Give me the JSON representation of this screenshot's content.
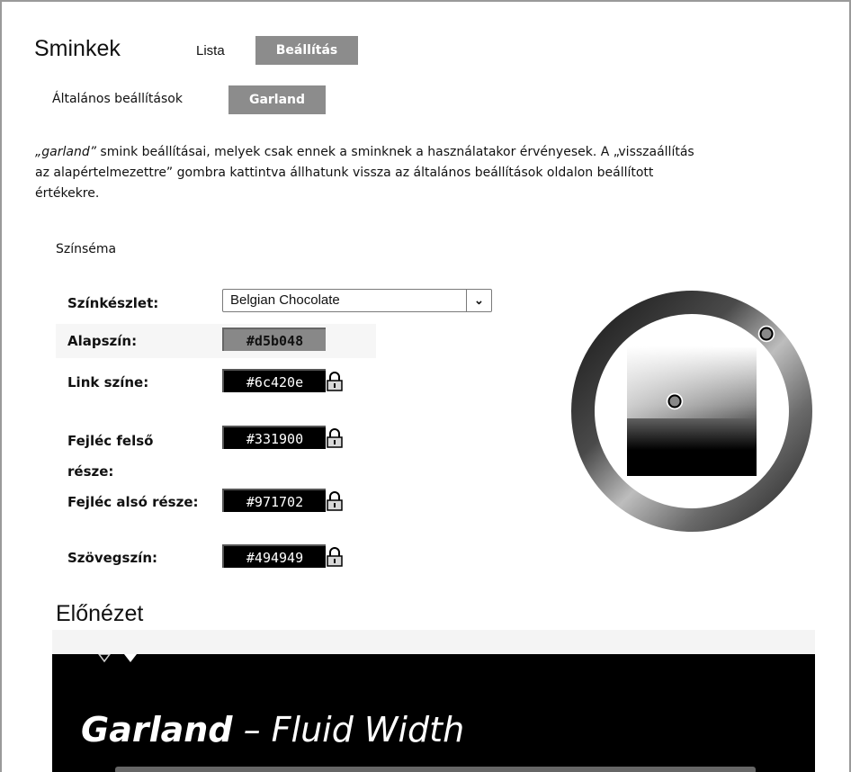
{
  "page": {
    "title": "Sminkek"
  },
  "tabs": {
    "list": "Lista",
    "settings": "Beállítás"
  },
  "subtabs": {
    "general": "Általános beállítások",
    "garland": "Garland"
  },
  "description": {
    "theme_name": "„garland”",
    "text_line1": " smink beállításai, melyek csak ennek a sminknek a használatakor érvényesek. A „visszaállítás",
    "text_line2": "az alapértelmezettre” gombra kattintva állhatunk vissza az általános beállítások oldalon beállított",
    "text_line3": "értékekre."
  },
  "color_scheme": {
    "section_label": "Színséma",
    "preset": {
      "label": "Színkészlet:",
      "value": "Belgian Chocolate"
    },
    "base": {
      "label": "Alapszín:",
      "value": "#d5b048"
    },
    "link": {
      "label": "Link színe:",
      "value": "#6c420e"
    },
    "top": {
      "label_line1": "Fejléc felső",
      "label_line2": "része:",
      "value": "#331900"
    },
    "bottom": {
      "label": "Fejléc alsó része:",
      "value": "#971702"
    },
    "text": {
      "label": "Szövegszín:",
      "value": "#494949"
    }
  },
  "preview": {
    "title": "Előnézet",
    "heading_bold": "Garland",
    "heading_rest": " – Fluid Width"
  },
  "icons": {
    "lock": "lock-icon",
    "dropdown": "chevron-down-icon"
  }
}
